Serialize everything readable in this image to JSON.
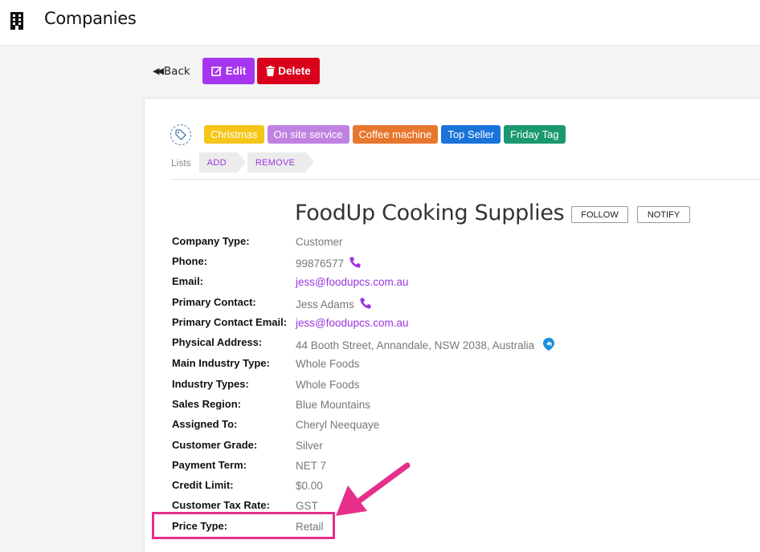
{
  "header": {
    "title": "Companies",
    "icon": "building-icon"
  },
  "toolbar": {
    "back_label": "Back",
    "edit_label": "Edit",
    "delete_label": "Delete"
  },
  "tags": [
    {
      "label": "Christmas",
      "color": "#f5c518"
    },
    {
      "label": "On site service",
      "color": "#c082e0"
    },
    {
      "label": "Coffee machine",
      "color": "#e8772e"
    },
    {
      "label": "Top Seller",
      "color": "#1a73d9"
    },
    {
      "label": "Friday Tag",
      "color": "#1a9870"
    }
  ],
  "lists": {
    "label": "Lists",
    "add_label": "ADD",
    "remove_label": "REMOVE"
  },
  "company": {
    "name": "FoodUp Cooking Supplies",
    "follow_label": "FOLLOW",
    "notify_label": "NOTIFY"
  },
  "fields": [
    {
      "label": "Company Type:",
      "value": "Customer"
    },
    {
      "label": "Phone:",
      "value": "99876577"
    },
    {
      "label": "Email:",
      "value": "jess@foodupcs.com.au"
    },
    {
      "label": "Primary Contact:",
      "value": "Jess Adams"
    },
    {
      "label": "Primary Contact Email:",
      "value": "jess@foodupcs.com.au"
    },
    {
      "label": "Physical Address:",
      "value": "44 Booth Street, Annandale, NSW 2038, Australia"
    },
    {
      "label": "Main Industry Type:",
      "value": "Whole Foods"
    },
    {
      "label": "Industry Types:",
      "value": "Whole Foods"
    },
    {
      "label": "Sales Region:",
      "value": "Blue Mountains"
    },
    {
      "label": "Assigned To:",
      "value": "Cheryl Neequaye"
    },
    {
      "label": "Customer Grade:",
      "value": "Silver"
    },
    {
      "label": "Payment Term:",
      "value": "NET 7"
    },
    {
      "label": "Credit Limit:",
      "value": "$0.00"
    },
    {
      "label": "Customer Tax Rate:",
      "value": "GST"
    },
    {
      "label": "Price Type:",
      "value": "Retail"
    }
  ],
  "colors": {
    "accent": "#a635f0",
    "danger": "#d9001b",
    "link": "#9b35e0",
    "annotation": "#e52f8a"
  }
}
